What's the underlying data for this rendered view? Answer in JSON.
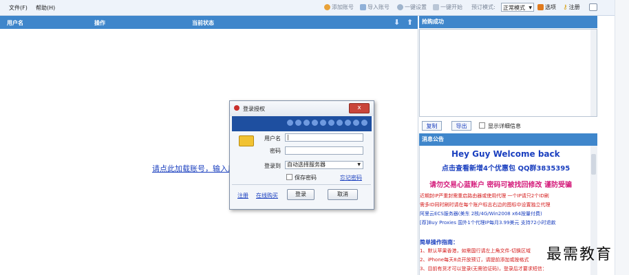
{
  "menu": {
    "file": "文件(F)",
    "help": "帮助(H)"
  },
  "toolbar": {
    "add_account": "添加账号",
    "import_account": "导入账号",
    "one_click_setup": "一键设置",
    "one_click_start": "一键开始",
    "schedule_mode": "预订模式:",
    "mode_value": "正常模式",
    "options": "选项",
    "register": "注册"
  },
  "list": {
    "col_username": "用户名",
    "col_action": "操作",
    "col_status": "当前状态",
    "hint": "请点此加载账号，输入用"
  },
  "right": {
    "success_title": "抢购成功",
    "copy": "复制",
    "export": "导出",
    "show_detail": "显示详细信息",
    "news_title": "消息公告"
  },
  "news": {
    "headline": "Hey Guy Welcome back",
    "promo": "点击查看新增4个优惠包 QQ群3835395",
    "warning": "请勿交易心蓝账户 密码可被找回修改 谨防受骗",
    "l1": "近期封IP严重封需重启路由器或使用代理 一个IP请只2个ID刷",
    "l2": "需多ID同时刷时请在每个账户标志右边的图标中设置独立代理",
    "l3": "阿里云ECS服务器(美东 2核/4G/Win2008 x64按量付费)",
    "l4": "[荐]Buy Proxies 国外1个代理IP每月3.99美元 支持72小时退款",
    "guide_title": "简单操作指南：",
    "g1": "1、默认苹果香港，如需国行请左上角文件-切换区域",
    "g2": "2、iPhone每天8点开放预订，请提前添加或按格式",
    "g3": "3、目前有货才可以登录(无需验证码)，登录后才要求短信："
  },
  "dialog": {
    "title": "登录授权",
    "close": "x",
    "username_label": "用户名",
    "password_label": "密码",
    "login_to_label": "登录到",
    "server_value": "自动选择服务器",
    "save_password": "保存密码",
    "forgot_password": "忘记密码",
    "register": "注册",
    "online_recharge": "在线购买",
    "login_button": "登录",
    "cancel_button": "取消"
  },
  "watermark": "最需教育"
}
